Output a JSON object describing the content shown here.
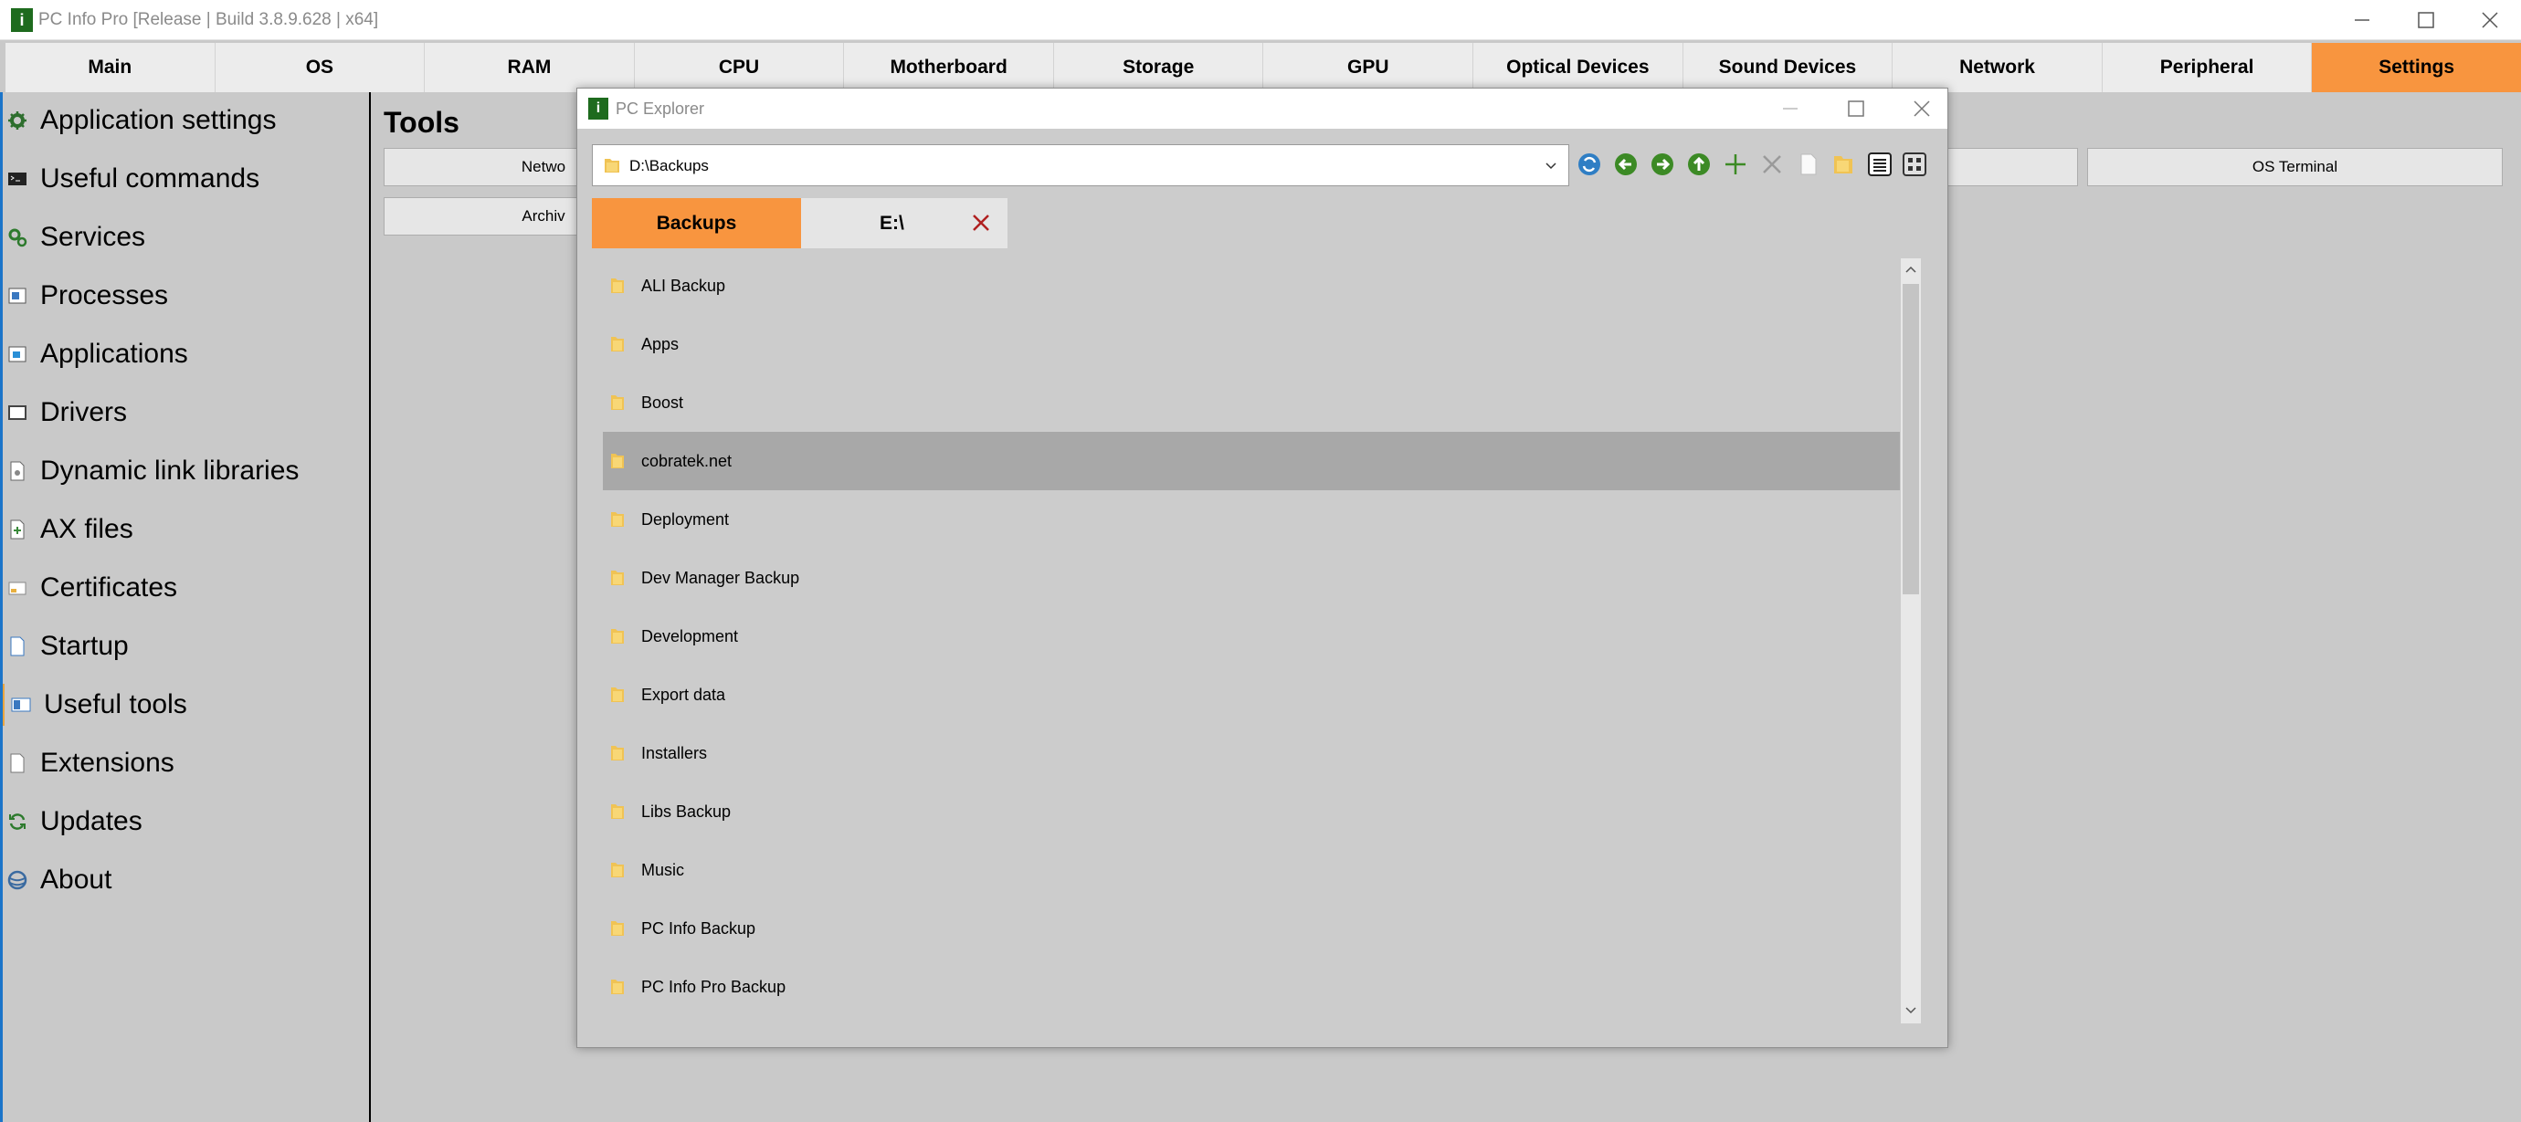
{
  "app": {
    "title": "PC Info Pro [Release | Build 3.8.9.628 | x64]",
    "icon_letter": "i"
  },
  "tabs": [
    {
      "label": "Main"
    },
    {
      "label": "OS"
    },
    {
      "label": "RAM"
    },
    {
      "label": "CPU"
    },
    {
      "label": "Motherboard"
    },
    {
      "label": "Storage"
    },
    {
      "label": "GPU"
    },
    {
      "label": "Optical Devices"
    },
    {
      "label": "Sound Devices"
    },
    {
      "label": "Network"
    },
    {
      "label": "Peripheral"
    },
    {
      "label": "Settings",
      "active": true
    }
  ],
  "sidebar": {
    "items": [
      {
        "label": "Application settings",
        "icon": "gear-icon"
      },
      {
        "label": "Useful commands",
        "icon": "terminal-icon"
      },
      {
        "label": "Services",
        "icon": "services-icon"
      },
      {
        "label": "Processes",
        "icon": "process-icon"
      },
      {
        "label": "Applications",
        "icon": "application-icon"
      },
      {
        "label": "Drivers",
        "icon": "driver-icon"
      },
      {
        "label": "Dynamic link libraries",
        "icon": "dll-icon"
      },
      {
        "label": "AX files",
        "icon": "ax-file-icon"
      },
      {
        "label": "Certificates",
        "icon": "certificate-icon"
      },
      {
        "label": "Startup",
        "icon": "startup-icon"
      },
      {
        "label": "Useful tools",
        "icon": "tools-icon",
        "selected": true
      },
      {
        "label": "Extensions",
        "icon": "extension-icon"
      },
      {
        "label": "Updates",
        "icon": "refresh-icon"
      },
      {
        "label": "About",
        "icon": "about-icon"
      }
    ]
  },
  "tools": {
    "title": "Tools",
    "buttons": [
      "Netwo",
      "Archiv",
      "OS Terminal"
    ]
  },
  "explorer": {
    "title": "PC Explorer",
    "path": "D:\\Backups",
    "tabs": [
      {
        "label": "Backups",
        "active": true
      },
      {
        "label": "E:\\"
      }
    ],
    "items": [
      {
        "name": "ALI Backup"
      },
      {
        "name": "Apps"
      },
      {
        "name": "Boost"
      },
      {
        "name": "cobratek.net",
        "selected": true
      },
      {
        "name": "Deployment"
      },
      {
        "name": "Dev Manager Backup"
      },
      {
        "name": "Development"
      },
      {
        "name": "Export data"
      },
      {
        "name": "Installers"
      },
      {
        "name": "Libs Backup"
      },
      {
        "name": "Music"
      },
      {
        "name": "PC Info Backup"
      },
      {
        "name": "PC Info Pro Backup"
      }
    ]
  },
  "colors": {
    "accent": "#f8953f",
    "selection_bar": "#e8a440",
    "app_icon": "#1e6b1e",
    "nav_green": "#3c8a25",
    "refresh_blue": "#2f7ec4"
  }
}
